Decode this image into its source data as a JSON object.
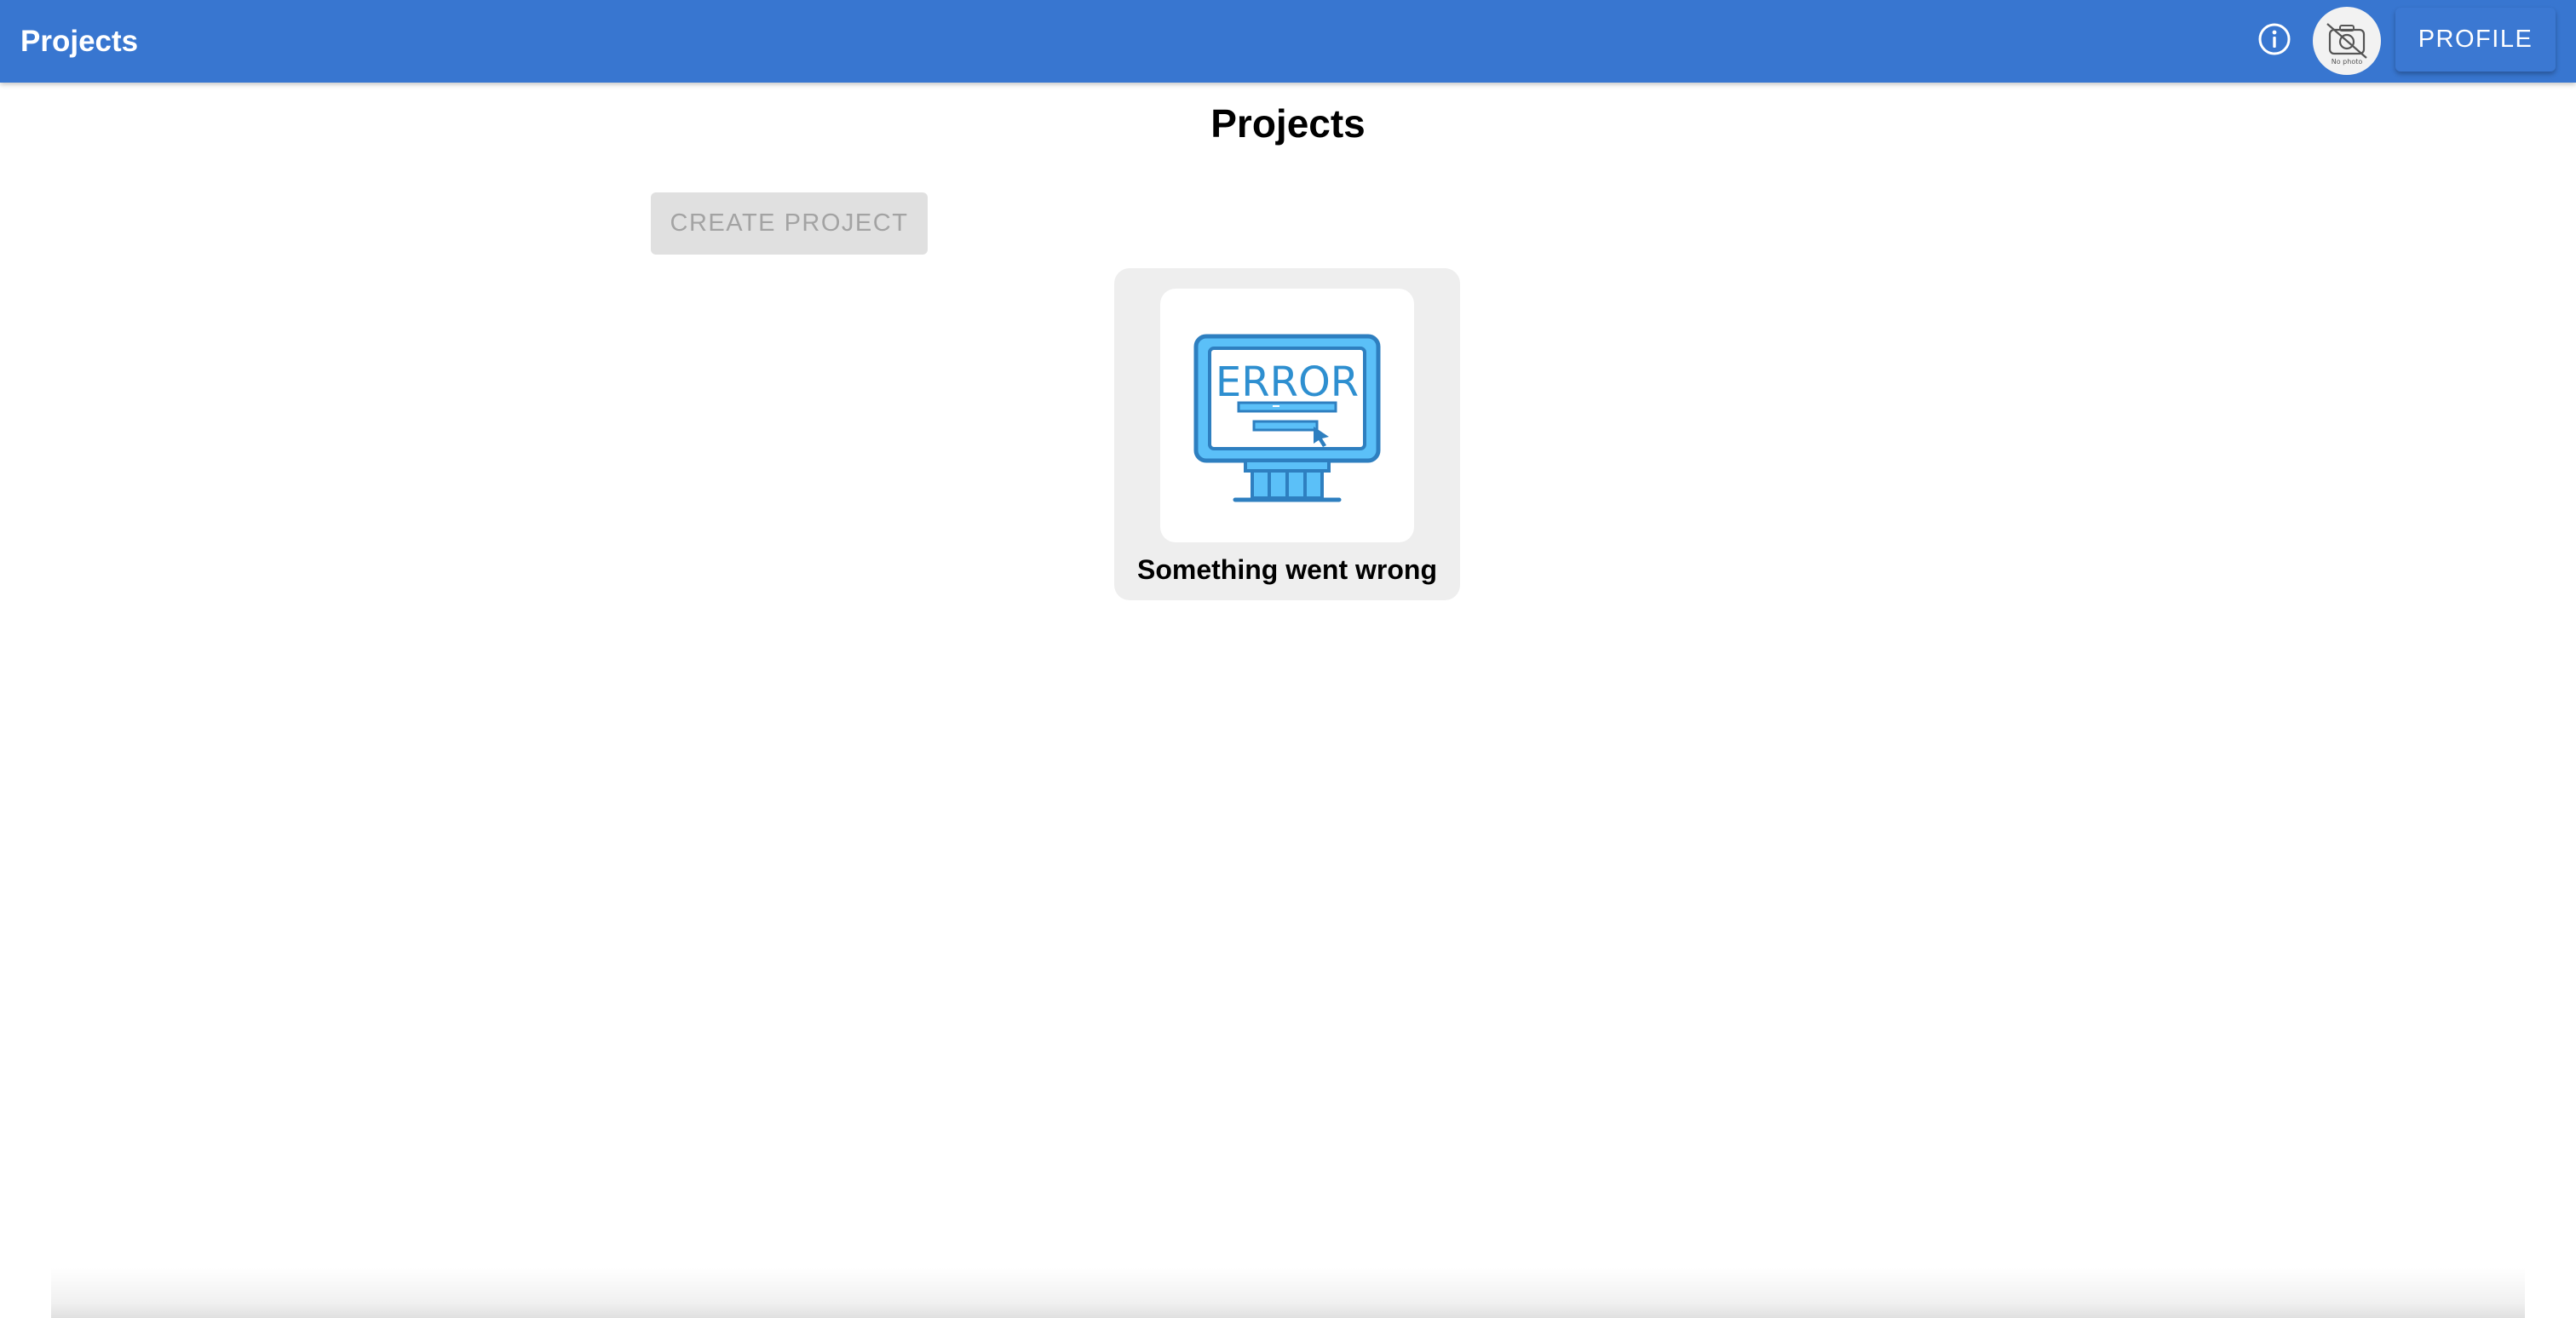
{
  "appbar": {
    "title": "Projects",
    "color": "#3876D0",
    "info_icon": "info-circle-icon",
    "avatar_icon": "no-photo-camera-icon",
    "avatar_caption": "No photo",
    "profile_label": "PROFILE"
  },
  "main": {
    "title": "Projects",
    "create_project_label": "CREATE PROJECT",
    "projects": [
      {
        "label": "Something went wrong",
        "image_icon": "error-monitor-icon",
        "image_text": "ERROR"
      }
    ]
  }
}
